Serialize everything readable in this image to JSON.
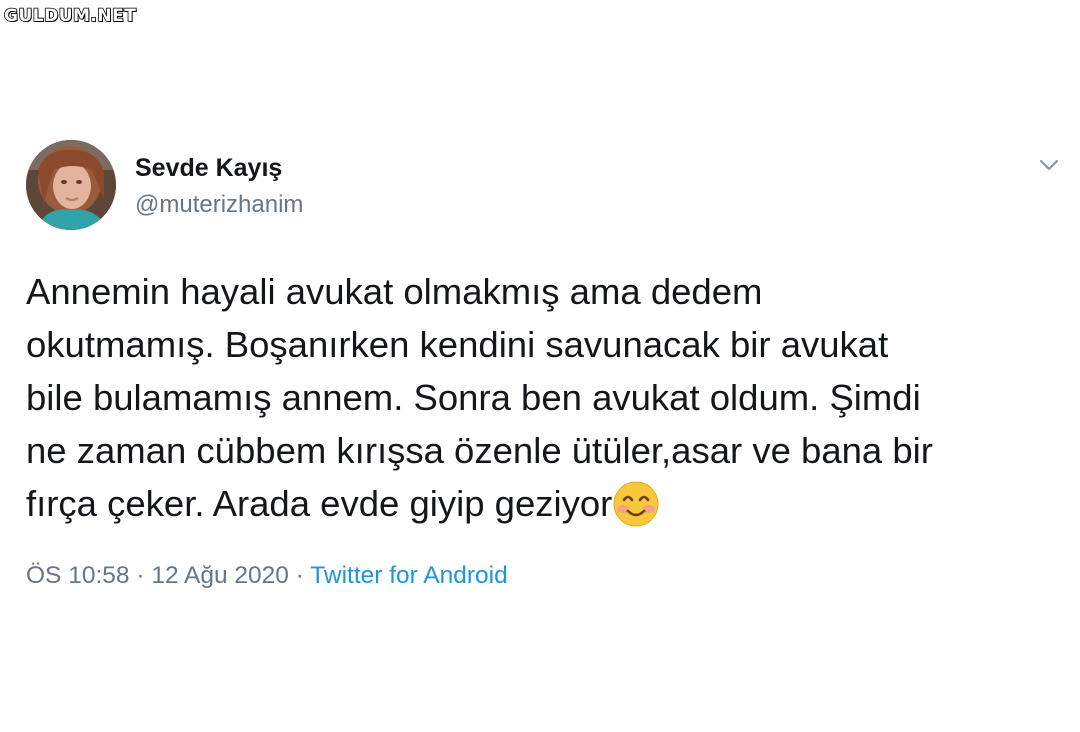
{
  "watermark": {
    "text": "GULDUM.NET"
  },
  "tweet": {
    "author": {
      "display_name": "Sevde Kayış",
      "handle": "@muterizhanim"
    },
    "menu_icon": "chevron-down-icon",
    "text": "Annemin hayali avukat olmakmış ama dedem\nokutmamış. Boşanırken kendini savunacak bir avukat\nbile bulamamış annem. Sonra ben avukat oldum. Şimdi\nne zaman cübbem kırışsa özenle ütüler,asar ve bana bir\nfırça çeker. Arada evde giyip geziyor",
    "emoji": "smiling-face-with-smiling-eyes-emoji",
    "time": "ÖS 10:58",
    "separator": "·",
    "date": "12 Ağu 2020",
    "source": "Twitter for Android"
  },
  "colors": {
    "text_primary": "#14171a",
    "text_secondary": "#657786",
    "link": "#1b95e0",
    "background": "#ffffff"
  }
}
